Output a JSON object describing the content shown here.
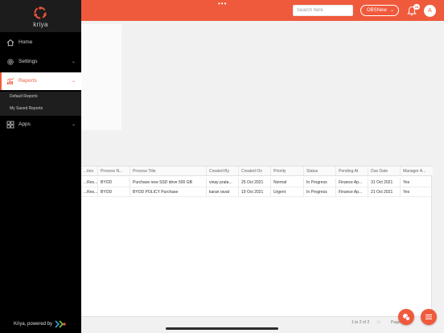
{
  "topbar": {
    "search_placeholder": "Search here",
    "company": "OBSNew",
    "notification_count": "10",
    "avatar_initial": "A"
  },
  "sidebar": {
    "brand": "kriya",
    "items": [
      {
        "label": "Home",
        "icon": "home-icon"
      },
      {
        "label": "Settings",
        "icon": "gear-icon"
      },
      {
        "label": "Reports",
        "icon": "chart-icon"
      },
      {
        "label": "Apps",
        "icon": "apps-icon"
      }
    ],
    "report_subitems": [
      "Default Reports",
      "My Saved Reports"
    ],
    "footer": "Kriya, powered by"
  },
  "table": {
    "columns": [
      "...tion",
      "Process N...",
      "Process Title",
      "Created By",
      "Created On",
      "Priority",
      "Status",
      "Pending At",
      "Due Date",
      "Manager A..."
    ],
    "rows": [
      [
        "...Res...",
        "BYOD",
        "Purchase new SSD drive 500 GB",
        "vinay prata...",
        "25 Oct 2021",
        "Normal",
        "In Progress",
        "Finance Ap...",
        "31 Oct 2021",
        "Yes"
      ],
      [
        "...Res...",
        "BYOD",
        "BYOD POLICY Purchase",
        "karan ravat",
        "19 Oct 2021",
        "Urgent",
        "In Progress",
        "Finance Ap...",
        "21 Oct 2021",
        "Yes"
      ]
    ]
  },
  "pagination": {
    "range": "1 to 2 of 2",
    "prev": "|<",
    "page_label": "Page"
  },
  "colors": {
    "accent": "#f05a3c",
    "sidebar": "#000000"
  }
}
